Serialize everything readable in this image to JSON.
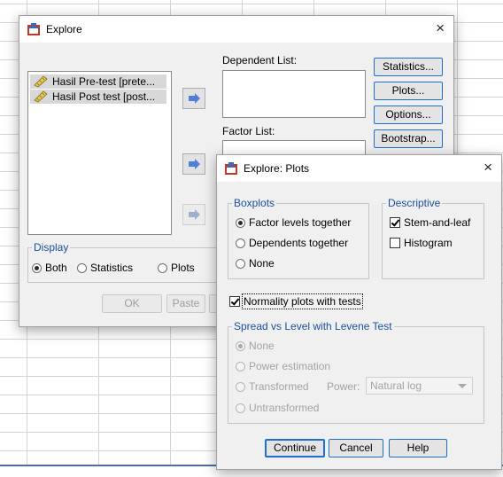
{
  "explore": {
    "title": "Explore",
    "close": "×",
    "dependent_list_label": "Dependent List:",
    "factor_list_label": "Factor List:",
    "variables": [
      "Hasil Pre-test [prete...",
      "Hasil Post test [post..."
    ],
    "buttons": {
      "statistics": "Statistics...",
      "plots": "Plots...",
      "options": "Options...",
      "bootstrap": "Bootstrap...",
      "ok": "OK",
      "paste": "Paste"
    },
    "display": {
      "label": "Display",
      "options": [
        "Both",
        "Statistics",
        "Plots"
      ],
      "selected": "Both"
    }
  },
  "plots": {
    "title": "Explore: Plots",
    "close": "×",
    "boxplots": {
      "label": "Boxplots",
      "options": [
        "Factor levels together",
        "Dependents together",
        "None"
      ],
      "selected": "Factor levels together"
    },
    "descriptive": {
      "label": "Descriptive",
      "stem_and_leaf": "Stem-and-leaf",
      "stem_checked": true,
      "histogram": "Histogram",
      "histogram_checked": false
    },
    "normality": {
      "label": "Normality plots with tests",
      "checked": true
    },
    "spread": {
      "label": "Spread vs Level with Levene Test",
      "options": [
        "None",
        "Power estimation",
        "Transformed",
        "Untransformed"
      ],
      "selected": "None",
      "power_label": "Power:",
      "power_value": "Natural log"
    },
    "buttons": {
      "continue": "Continue",
      "cancel": "Cancel",
      "help": "Help"
    }
  },
  "colors": {
    "accent": "#1f6fd1",
    "group_title": "#1a4f9a",
    "arrow": "#4f7fd6"
  },
  "icons": {
    "app": "spss-app-icon",
    "variable": "ruler-scale-icon",
    "move": "move-right-arrow-icon"
  }
}
